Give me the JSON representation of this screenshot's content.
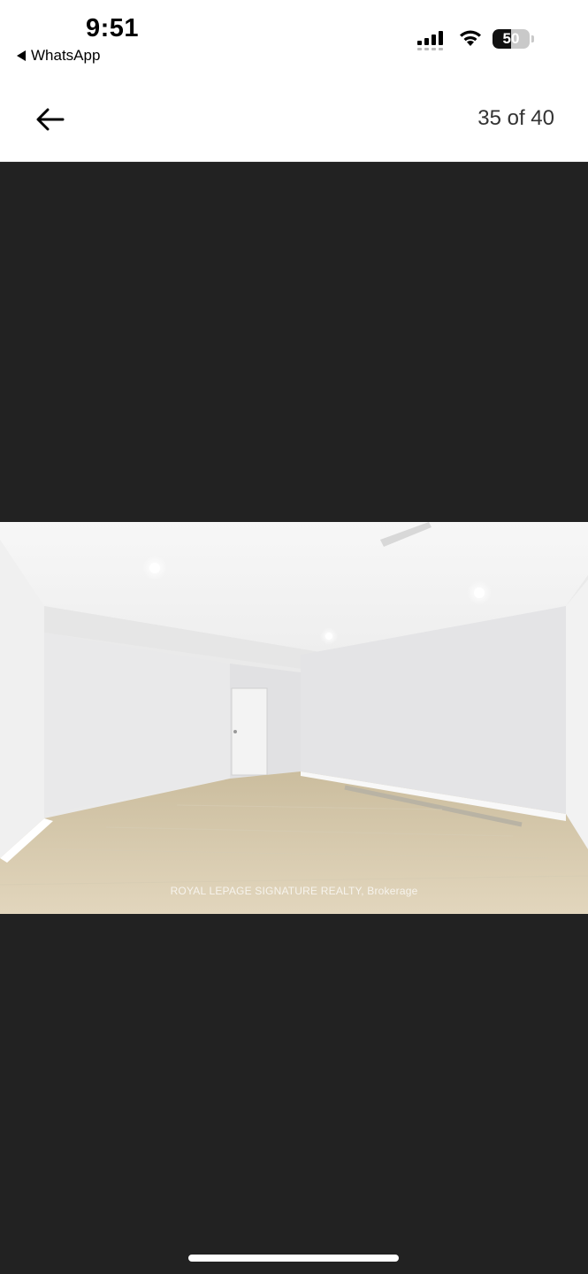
{
  "status_bar": {
    "time": "9:51",
    "back_app_label": "WhatsApp",
    "signal_icon": "cellular-signal-icon",
    "wifi_icon": "wifi-icon",
    "battery_level": "50",
    "battery_fraction": 0.5
  },
  "header": {
    "back_icon": "back-arrow-icon",
    "counter": "35 of 40"
  },
  "photo": {
    "watermark": "ROYAL LEPAGE SIGNATURE REALTY, Brokerage"
  },
  "colors": {
    "viewer_background": "#222222",
    "header_background": "#ffffff",
    "text_primary": "#000000"
  }
}
